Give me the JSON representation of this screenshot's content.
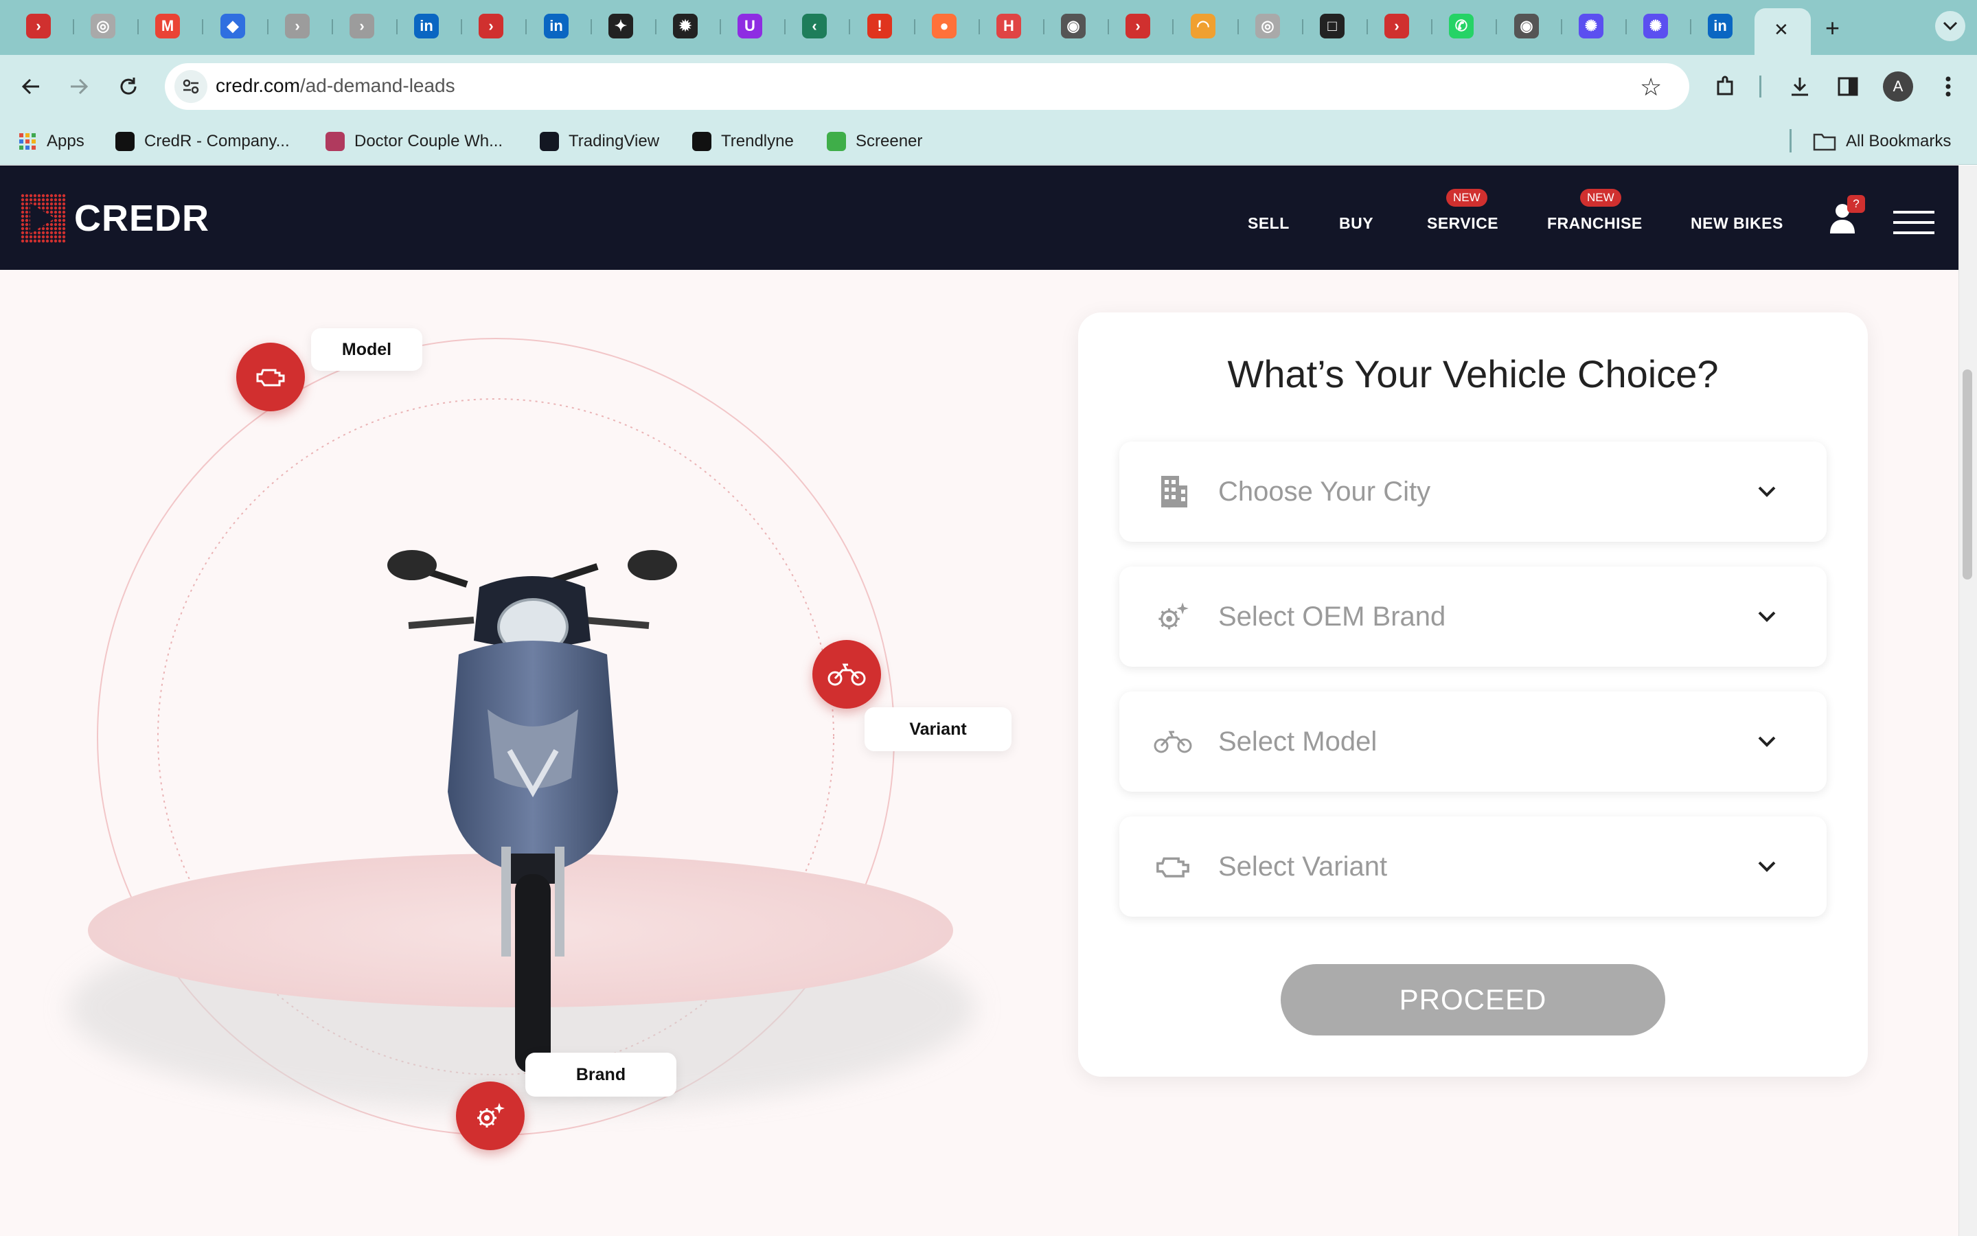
{
  "browser": {
    "url_domain": "credr.com",
    "url_path": "/ad-demand-leads",
    "profile_initial": "A",
    "tab_close": "✕",
    "new_tab": "+",
    "tabs": [
      {
        "icon": "credr-icon",
        "color": "#d0302f",
        "glyph": "›"
      },
      {
        "icon": "openai-icon",
        "color": "#a9a9a9",
        "glyph": "◎"
      },
      {
        "icon": "gmail-icon",
        "color": "#ea4335",
        "glyph": "M"
      },
      {
        "icon": "shield-tab-icon",
        "color": "#2f6fe0",
        "glyph": "◆"
      },
      {
        "icon": "credr-grey-icon",
        "color": "#9c9c9c",
        "glyph": "›"
      },
      {
        "icon": "credr-grey-icon",
        "color": "#9c9c9c",
        "glyph": "›"
      },
      {
        "icon": "linkedin-icon",
        "color": "#0a66c2",
        "glyph": "in"
      },
      {
        "icon": "credr-icon",
        "color": "#d0302f",
        "glyph": "›"
      },
      {
        "icon": "linkedin-icon",
        "color": "#0a66c2",
        "glyph": "in"
      },
      {
        "icon": "runner-icon",
        "color": "#222222",
        "glyph": "✦"
      },
      {
        "icon": "gear-tab-icon",
        "color": "#222222",
        "glyph": "✹"
      },
      {
        "icon": "u-icon",
        "color": "#8e2de2",
        "glyph": "U"
      },
      {
        "icon": "leaf-icon",
        "color": "#1e7d5a",
        "glyph": "‹"
      },
      {
        "icon": "alert-icon",
        "color": "#e0341e",
        "glyph": "!"
      },
      {
        "icon": "firefox-icon",
        "color": "#ff7139",
        "glyph": "●"
      },
      {
        "icon": "h-icon",
        "color": "#e04444",
        "glyph": "H"
      },
      {
        "icon": "chrome-icon",
        "color": "#555555",
        "glyph": "◉"
      },
      {
        "icon": "credr-icon",
        "color": "#d0302f",
        "glyph": "›"
      },
      {
        "icon": "rainbow-icon",
        "color": "#f0a030",
        "glyph": "◠"
      },
      {
        "icon": "openai-icon",
        "color": "#a9a9a9",
        "glyph": "◎"
      },
      {
        "icon": "square-icon",
        "color": "#222222",
        "glyph": "□"
      },
      {
        "icon": "credr-icon",
        "color": "#d0302f",
        "glyph": "›"
      },
      {
        "icon": "whatsapp-icon",
        "color": "#25d366",
        "glyph": "✆"
      },
      {
        "icon": "chrome-icon",
        "color": "#555555",
        "glyph": "◉"
      },
      {
        "icon": "asterisk-icon",
        "color": "#5b4ff0",
        "glyph": "✺"
      },
      {
        "icon": "asterisk-icon",
        "color": "#5b4ff0",
        "glyph": "✺"
      },
      {
        "icon": "linkedin-icon",
        "color": "#0a66c2",
        "glyph": "in"
      }
    ],
    "bookmarks": [
      {
        "label": "Apps",
        "icon": "apps-grid-icon",
        "color": "#e8e8e8"
      },
      {
        "label": "CredR - Company...",
        "icon": "credr-bookmark-icon",
        "color": "#111111"
      },
      {
        "label": "Doctor Couple Wh...",
        "icon": "doctor-icon",
        "color": "#b03a5e"
      },
      {
        "label": "TradingView",
        "icon": "tradingview-icon",
        "color": "#131722"
      },
      {
        "label": "Trendlyne",
        "icon": "trendlyne-icon",
        "color": "#111111"
      },
      {
        "label": "Screener",
        "icon": "screener-icon",
        "color": "#3fae49"
      }
    ],
    "all_bookmarks": "All Bookmarks"
  },
  "site": {
    "logo_text": "CREDR",
    "brand_color": "#d0302f",
    "header_bg": "#121527",
    "nav": [
      {
        "label": "SELL",
        "badge": ""
      },
      {
        "label": "BUY",
        "badge": ""
      },
      {
        "label": "SERVICE",
        "badge": "NEW"
      },
      {
        "label": "FRANCHISE",
        "badge": "NEW"
      },
      {
        "label": "NEW BIKES",
        "badge": ""
      }
    ],
    "notification_badge": "?"
  },
  "hero": {
    "labels": {
      "model": "Model",
      "variant": "Variant",
      "brand": "Brand"
    }
  },
  "form": {
    "title": "What’s Your Vehicle Choice?",
    "fields": [
      {
        "placeholder": "Choose Your City",
        "icon": "building-icon"
      },
      {
        "placeholder": "Select OEM Brand",
        "icon": "gears-icon"
      },
      {
        "placeholder": "Select Model",
        "icon": "motorcycle-icon"
      },
      {
        "placeholder": "Select Variant",
        "icon": "engine-icon"
      }
    ],
    "submit_label": "PROCEED",
    "submit_color": "#ababab"
  }
}
